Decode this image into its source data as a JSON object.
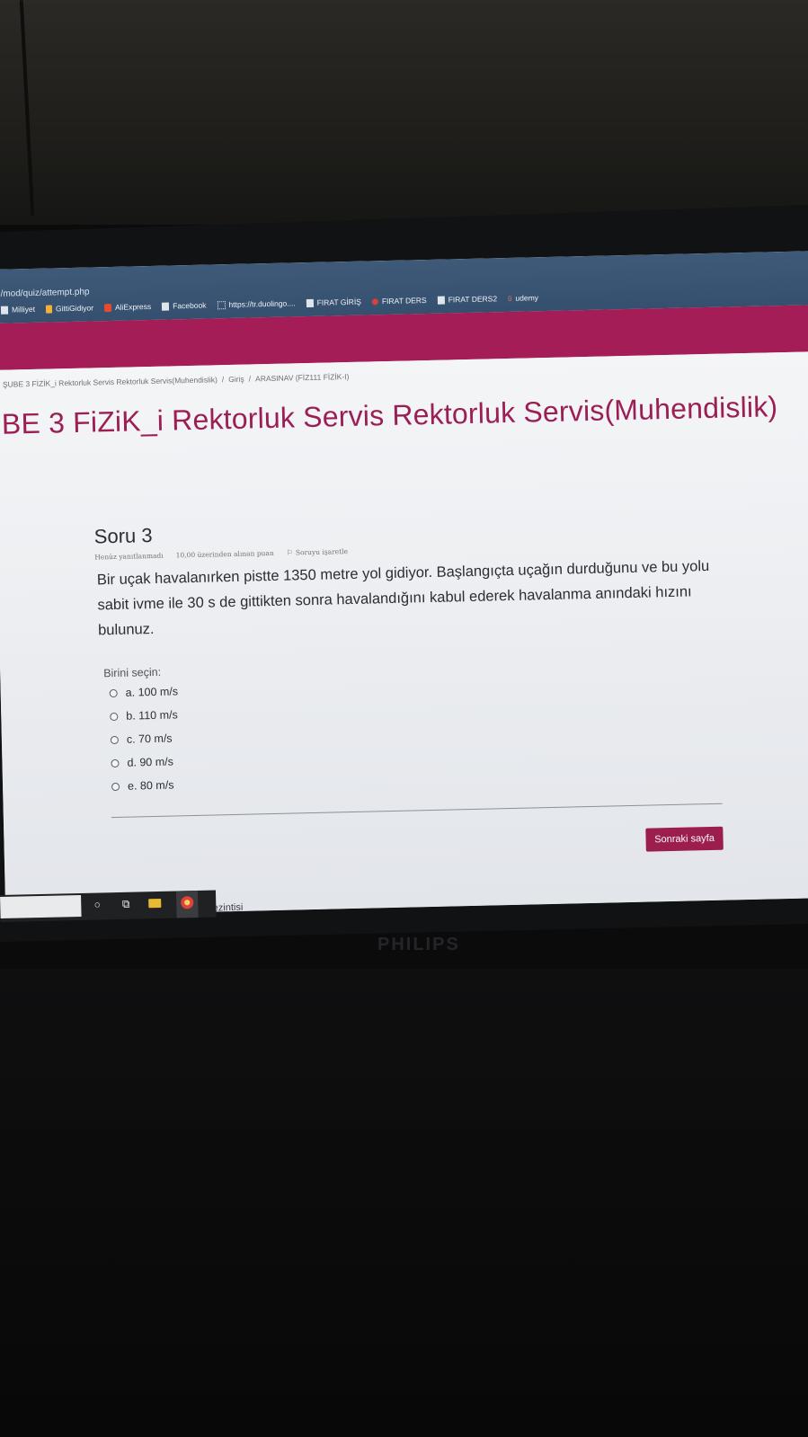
{
  "browser": {
    "url": "/mod/quiz/attempt.php",
    "bookmarks": [
      {
        "label": "Milliyet",
        "icon": "milliyet-icon"
      },
      {
        "label": "GittiGidiyor",
        "icon": "gittigidiyor-icon"
      },
      {
        "label": "AliExpress",
        "icon": "aliexpress-icon"
      },
      {
        "label": "Facebook",
        "icon": "page-icon"
      },
      {
        "label": "https://tr.duolingo....",
        "icon": "grid-icon"
      },
      {
        "label": "FIRAT GİRİŞ",
        "icon": "page-icon"
      },
      {
        "label": "FIRAT DERS",
        "icon": "firat-icon"
      },
      {
        "label": "FIRAT DERS2",
        "icon": "page-icon"
      },
      {
        "label": "udemy",
        "icon": "udemy-icon"
      }
    ]
  },
  "breadcrumb": {
    "course": "ŞUBE 3 FİZİK_i Rektorluk Servis Rektorluk Servis(Muhendislik)",
    "section": "Giriş",
    "quiz": "ARASINAV (FİZ111 FİZİK-I)"
  },
  "course_title": "BE 3 FiZiK_i Rektorluk Servis Rektorluk Servis(Muhendislik)",
  "question": {
    "number": "Soru 3",
    "status": "Henüz yanıtlanmadı",
    "points": "10,00 üzerinden alınan puan",
    "flag": "Soruyu işaretle",
    "text": "Bir uçak havalanırken pistte 1350 metre yol gidiyor. Başlangıçta uçağın durduğunu ve bu yolu sabit ivme ile 30 s de gittikten sonra havalandığını kabul ederek havalanma anındaki hızını bulunuz.",
    "prompt": "Birini seçin:",
    "options": [
      "a. 100 m/s",
      "b. 110 m/s",
      "c. 70 m/s",
      "d. 90 m/s",
      "e. 80 m/s"
    ]
  },
  "next_button": "Sonraki sayfa",
  "below_fold_text": "Kısa sınav gezintisi",
  "monitor_brand": "PHILIPS",
  "colors": {
    "brand": "#a41d56",
    "title": "#9b1e55",
    "button": "#9b1e4e",
    "browser_chrome": "#3f5a78"
  }
}
